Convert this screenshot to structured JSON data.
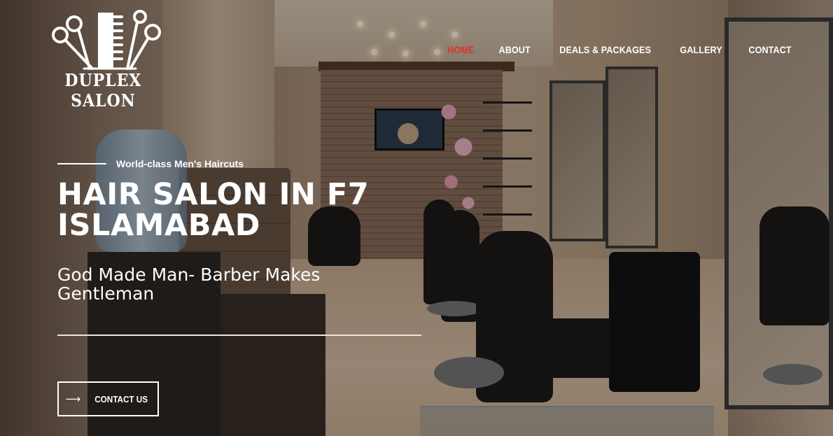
{
  "brand": {
    "name": "DUPLEX SALON",
    "logo_icon": "scissors-comb-icon"
  },
  "nav": {
    "items": [
      {
        "label": "HOME",
        "active": true
      },
      {
        "label": "ABOUT",
        "active": false
      },
      {
        "label": "DEALS & PACKAGES",
        "active": false
      },
      {
        "label": "GALLERY",
        "active": false
      },
      {
        "label": "CONTACT",
        "active": false
      }
    ],
    "active_color": "#e0322b"
  },
  "hero": {
    "tagline": "World-class Men's Haircuts",
    "headline": "HAIR SALON IN F7 ISLAMABAD",
    "subhead": "God Made Man- Barber Makes Gentleman",
    "cta": {
      "label": "CONTACT US",
      "icon": "arrow-right-icon"
    }
  }
}
